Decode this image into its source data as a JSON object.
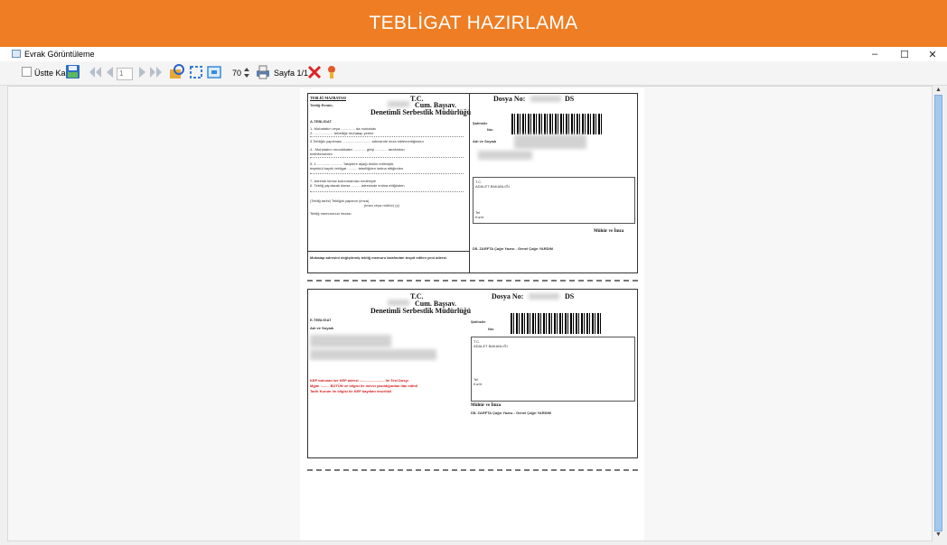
{
  "banner": {
    "title": "TEBLİGAT HAZIRLAMA"
  },
  "window": {
    "title": "Evrak Görüntüleme",
    "minimize": "–",
    "maximize": "☐",
    "close": "✕"
  },
  "toolbar": {
    "stay_on_top_label": "Üstte Kal",
    "page_number": "1",
    "zoom_value": "70",
    "page_label": "Sayfa 1/1"
  },
  "document": {
    "top": {
      "header_left": "TEBLİĞ MAZBATASI",
      "tc": "T.C.",
      "dosya_label": "Dosya No:",
      "ds": "DS",
      "cum_bsavc": "Cum. Başsav.",
      "directorate": "Denetimli Serbestlik Müdürlüğü",
      "teblig_evrakinin": "Tebliğ Evrakı,",
      "section": "A-TEBLİGAT",
      "ilce_label": "Ilce.",
      "row1": "1- Muhatabın veya .............. da muhatabı",
      "row2": "2- ................... tebelliğe muhatap yerine",
      "row3": "3.Tebliğin yapılması ............................ adresinde imza edilemediğinden",
      "row4": "4.- Muhatabın muvakkaten ............ girişi ............ tarafından",
      "row4b": "belirtilemeden",
      "row5": "5- 1 ......................... Takiplere aşağı teslim edilmiştir,",
      "row5b": "teşekkül kayıtlı tebligat .......... tebelliğden imtina ettiğinden",
      "row6": "6- Tebliğ yapılacak kimse ......... adresinde imtina ettiğinden",
      "row7": "7- Adreste kimse bulunmaması nedeniyle",
      "row8": "(Tebliğ tarihi)           Tebliğat yapanın         (imza)",
      "row8b": "(imza veya mühür) (ç)",
      "row9": "Tebliğ memurunun imzası",
      "sami_ila": "Şahhsile",
      "sami_no": "Noı",
      "adi_soyadi": "Adı ve Soyadı",
      "tc_small": "T.C.",
      "ministry": "ADALET BAKANLIĞI",
      "tel": "Tel",
      "kizb": "Kız/ıt",
      "muhur": "Mühür ve İmza",
      "bottom_left": "Muhatap adresini değiştirmiş tebliğ memuru tarafından tespit edilen yeni adresi",
      "bottom_right": "DİL ZARFTA Çağrı Yazısı - Genel Çağrı YARDIM"
    },
    "bottom": {
      "tc": "T.C.",
      "dosya_label": "Dosya No:",
      "ds": "DS",
      "cum_bsavc": "Cum. Başsav.",
      "directorate": "Denetimli Serbestlik Müdürlüğü",
      "section": "E-TEBLİGAT",
      "adi_soyadi": "Adı ve Soyadı",
      "sami_ila": "Şahhsile",
      "sami_no": "Noı",
      "tc_small": "T.C.",
      "ministry": "ADALET BAKANLIĞI",
      "tel": "Tel",
      "kizb": "Kız/ıt",
      "red1": "KEP bulunan ise KEP adresi ......................... ile Tesi Dosyı",
      "red2": "Mğım ......... BÜTÜN ve bilgisi ile mevcı yazıldığından ilan edildi",
      "red3": "Tarih Kurum Ve bilgisi ile KEP kayıtları öncelikli",
      "muhur": "Mühür ve İmza",
      "bottom_right": "DİL ZARFTA Çağrı Yazısı - Genel Çağrı YARDIM"
    }
  },
  "colors": {
    "banner": "#ee7d23",
    "scroll_thumb": "#a4c8ee",
    "red_text": "#d61b1b"
  },
  "icons": [
    "window-icon",
    "save-icon",
    "first-page-icon",
    "prev-page-icon",
    "next-page-icon",
    "last-page-icon",
    "refresh-icon",
    "fit-icon",
    "fit-width-icon",
    "zoom-spin-icon",
    "print-icon",
    "close-doc-icon",
    "pin-icon"
  ]
}
